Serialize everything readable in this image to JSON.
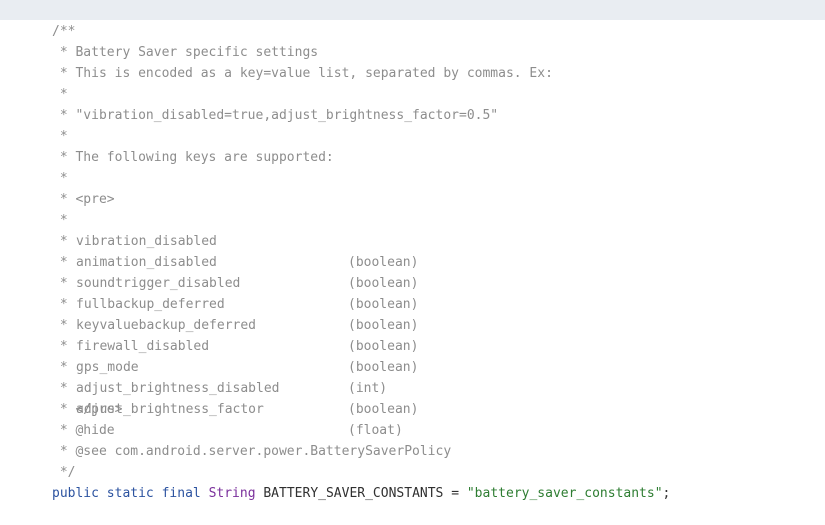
{
  "editor": {
    "doc_open": "/**",
    "lines": [
      " * Battery Saver specific settings",
      " * This is encoded as a key=value list, separated by commas. Ex:",
      " *",
      " * \"vibration_disabled=true,adjust_brightness_factor=0.5\"",
      " *",
      " * The following keys are supported:",
      " *",
      " * <pre>"
    ],
    "keys": [
      {
        "name": "vibration_disabled",
        "type": "(boolean)"
      },
      {
        "name": "animation_disabled",
        "type": "(boolean)"
      },
      {
        "name": "soundtrigger_disabled",
        "type": "(boolean)"
      },
      {
        "name": "fullbackup_deferred",
        "type": "(boolean)"
      },
      {
        "name": "keyvaluebackup_deferred",
        "type": "(boolean)"
      },
      {
        "name": "firewall_disabled",
        "type": "(boolean)"
      },
      {
        "name": "gps_mode",
        "type": "(int)"
      },
      {
        "name": "adjust_brightness_disabled",
        "type": "(boolean)"
      },
      {
        "name": "adjust_brightness_factor",
        "type": "(float)"
      }
    ],
    "tail_lines": [
      " * </pre>",
      " * @hide",
      " * @see com.android.server.power.BatterySaverPolicy",
      " */"
    ],
    "declaration": {
      "kw_public": "public",
      "kw_static": "static",
      "kw_final": "final",
      "type": "String",
      "name": "BATTERY_SAVER_CONSTANTS",
      "equals": "=",
      "value": "\"battery_saver_constants\"",
      "semicolon": ";"
    },
    "colors": {
      "comment": "#8d8d8d",
      "keyword": "#2c53a0",
      "type": "#7a2f9b",
      "string": "#2e7d32",
      "current_line": "#e9edf2"
    }
  }
}
